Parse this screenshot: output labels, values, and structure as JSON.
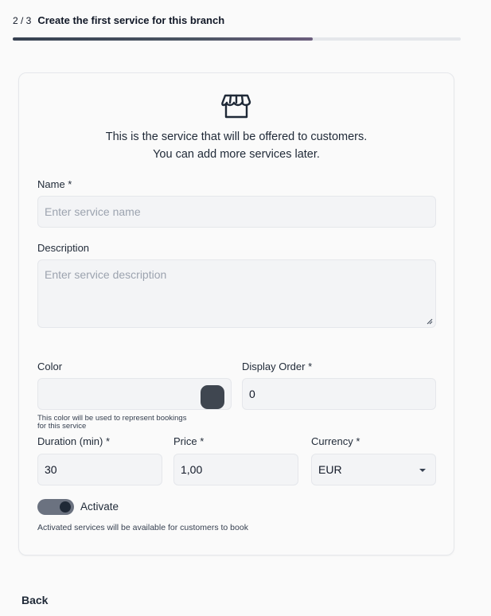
{
  "header": {
    "step": "2 / 3",
    "title": "Create the first service for this branch",
    "progress": 0.67
  },
  "card": {
    "icon": "storefront-icon",
    "intro_line1": "This is the service that will be offered to customers.",
    "intro_line2": "You can add more services later."
  },
  "form": {
    "name_label": "Name *",
    "name_placeholder": "Enter service name",
    "name_value": "",
    "description_label": "Description",
    "description_placeholder": "Enter service description",
    "description_value": "",
    "color_label": "Color",
    "color_value": "#3f4650",
    "color_helper_line1": "This color will be used to represent bookings",
    "color_helper_line2": "for this service",
    "display_order_label": "Display Order *",
    "display_order_value": "0",
    "duration_label": "Duration (min) *",
    "duration_value": "30",
    "price_label": "Price *",
    "price_value": "1,00",
    "currency_label": "Currency *",
    "currency_value": "EUR",
    "activate_label": "Activate",
    "activate_on": true,
    "activate_helper": "Activated services will be available for customers to book"
  },
  "footer": {
    "back_label": "Back"
  },
  "colors": {
    "accent": "#374151",
    "swatch": "#3f4650",
    "input_bg": "#f3f4f6"
  }
}
